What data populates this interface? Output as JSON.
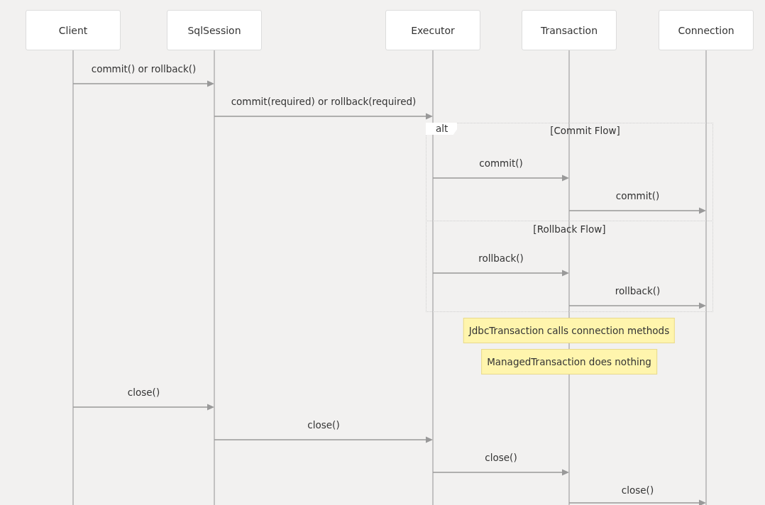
{
  "participants": [
    {
      "name": "Client"
    },
    {
      "name": "SqlSession"
    },
    {
      "name": "Executor"
    },
    {
      "name": "Transaction"
    },
    {
      "name": "Connection"
    }
  ],
  "steps": [
    {
      "kind": "client-call",
      "label": "commit() or rollback()"
    },
    {
      "kind": "session-call",
      "label": "commit(required) or rollback(required)"
    },
    {
      "kind": "alt",
      "label": "alt",
      "sections": [
        {
          "condition": "[Commit Flow]",
          "messages": [
            {
              "kind": "executor-call",
              "label": "commit()"
            },
            {
              "kind": "transaction-call",
              "label": "commit()"
            }
          ]
        },
        {
          "condition": "[Rollback Flow]",
          "messages": [
            {
              "kind": "executor-call",
              "label": "rollback()"
            },
            {
              "kind": "transaction-call",
              "label": "rollback()"
            }
          ]
        }
      ]
    },
    {
      "kind": "transaction-note",
      "text": "JdbcTransaction calls connection methods"
    },
    {
      "kind": "transaction-note",
      "text": "ManagedTransaction does nothing"
    },
    {
      "kind": "client-call",
      "label": "close()"
    },
    {
      "kind": "session-call",
      "label": "close()"
    },
    {
      "kind": "executor-call",
      "label": "close()"
    },
    {
      "kind": "transaction-call",
      "label": "close()"
    }
  ]
}
